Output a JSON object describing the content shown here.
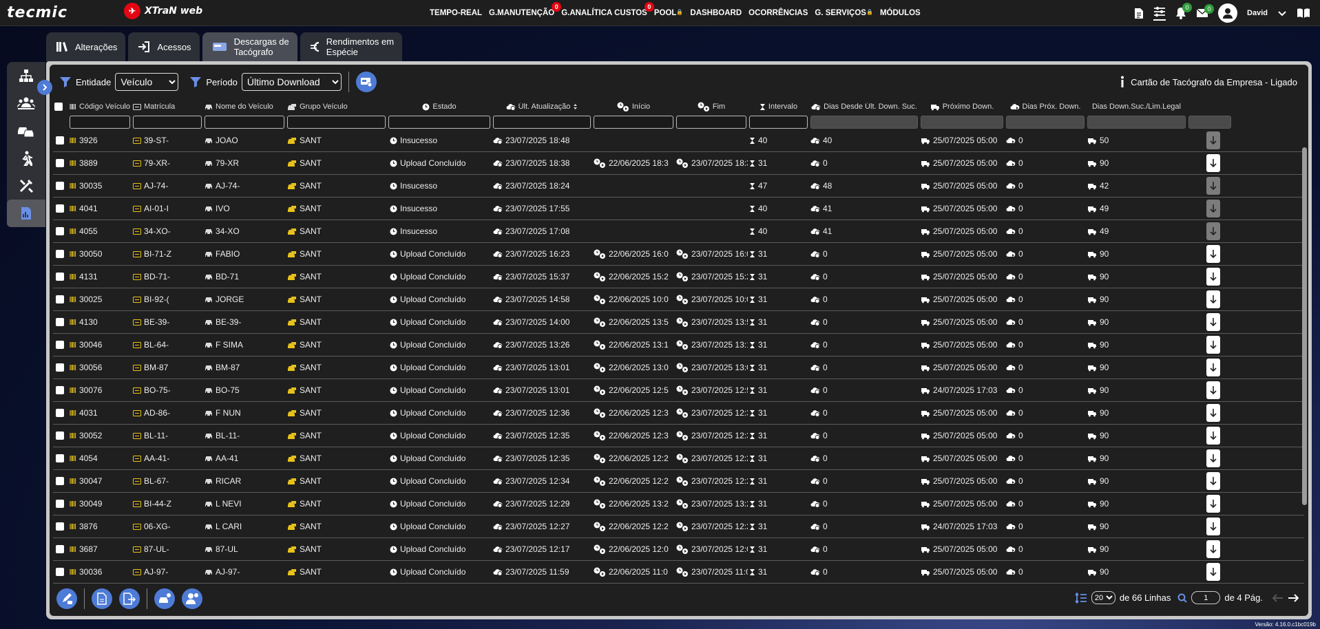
{
  "brand": {
    "logo": "tecmic",
    "product": "XTraN web"
  },
  "topnav": [
    {
      "label": "TEMPO-REAL"
    },
    {
      "label": "G.MANUTENÇÃO",
      "badge": "0"
    },
    {
      "label": "G.ANALÍTICA CUSTOS",
      "badge": "0"
    },
    {
      "label": "POOL",
      "locked": true
    },
    {
      "label": "DASHBOARD"
    },
    {
      "label": "OCORRÊNCIAS"
    },
    {
      "label": "G. SERVIÇOS",
      "locked": true
    },
    {
      "label": "MÓDULOS"
    }
  ],
  "user": {
    "name": "David",
    "notifications": "0",
    "messages": "0"
  },
  "tabs": [
    {
      "label": "Alterações",
      "icon": "books-icon"
    },
    {
      "label": "Acessos",
      "icon": "login-icon"
    },
    {
      "label": "Descargas de\nTacógrafo",
      "icon": "tachograph-card-icon",
      "active": true
    },
    {
      "label": "Rendimentos em\nEspécie",
      "icon": "euro-icon"
    }
  ],
  "sidenav": [
    "hierarchy-icon",
    "group-icon",
    "vehicles-icon",
    "person-walking-icon",
    "tools-icon",
    "report-icon"
  ],
  "filters": {
    "entity_label": "Entidade",
    "entity_value": "Veículo",
    "period_label": "Período",
    "period_value": "Último Download"
  },
  "card_status": "Cartão de Tacógrafo da Empresa - Ligado",
  "columns": [
    "Código Veículo",
    "Matrícula",
    "Nome do Veículo",
    "Grupo Veículo",
    "Estado",
    "Últ. Atualização",
    "Início",
    "Fim",
    "Intervalo",
    "Dias Desde Últ. Down. Suc.",
    "Próximo Down.",
    "Dias Próx. Down.",
    "Dias Down.Suc./Lim.Legal"
  ],
  "rows": [
    {
      "code": "3926",
      "plate": "39-ST-",
      "name": "JOAO",
      "group": "SANT",
      "state": "Insucesso",
      "updated": "23/07/2025 18:48",
      "start": "",
      "end": "",
      "interval": "40",
      "days_since": "40",
      "next": "25/07/2025 05:00",
      "days_next": "0",
      "limit": "50",
      "dl": false
    },
    {
      "code": "3889",
      "plate": "79-XR-",
      "name": "79-XR",
      "group": "SANT",
      "state": "Upload Concluído",
      "updated": "23/07/2025 18:38",
      "start": "22/06/2025 18:3",
      "end": "23/07/2025 18:3",
      "interval": "31",
      "days_since": "0",
      "next": "25/07/2025 05:00",
      "days_next": "0",
      "limit": "90",
      "dl": true
    },
    {
      "code": "30035",
      "plate": "AJ-74-",
      "name": "AJ-74-",
      "group": "SANT",
      "state": "Insucesso",
      "updated": "23/07/2025 18:24",
      "start": "",
      "end": "",
      "interval": "47",
      "days_since": "48",
      "next": "25/07/2025 05:00",
      "days_next": "0",
      "limit": "42",
      "dl": false
    },
    {
      "code": "4041",
      "plate": "AI-01-I",
      "name": "IVO",
      "group": "SANT",
      "state": "Insucesso",
      "updated": "23/07/2025 17:55",
      "start": "",
      "end": "",
      "interval": "40",
      "days_since": "41",
      "next": "25/07/2025 05:00",
      "days_next": "0",
      "limit": "49",
      "dl": false
    },
    {
      "code": "4055",
      "plate": "34-XO-",
      "name": "34-XO",
      "group": "SANT",
      "state": "Insucesso",
      "updated": "23/07/2025 17:08",
      "start": "",
      "end": "",
      "interval": "40",
      "days_since": "41",
      "next": "25/07/2025 05:00",
      "days_next": "0",
      "limit": "49",
      "dl": false
    },
    {
      "code": "30050",
      "plate": "BI-71-Z",
      "name": "FABIO",
      "group": "SANT",
      "state": "Upload Concluído",
      "updated": "23/07/2025 16:23",
      "start": "22/06/2025 16:0",
      "end": "23/07/2025 16:0",
      "interval": "31",
      "days_since": "0",
      "next": "25/07/2025 05:00",
      "days_next": "0",
      "limit": "90",
      "dl": true
    },
    {
      "code": "4131",
      "plate": "BD-71-",
      "name": "BD-71",
      "group": "SANT",
      "state": "Upload Concluído",
      "updated": "23/07/2025 15:37",
      "start": "22/06/2025 15:2",
      "end": "23/07/2025 15:2",
      "interval": "31",
      "days_since": "0",
      "next": "25/07/2025 05:00",
      "days_next": "0",
      "limit": "90",
      "dl": true
    },
    {
      "code": "30025",
      "plate": "BI-92-(",
      "name": "JORGE",
      "group": "SANT",
      "state": "Upload Concluído",
      "updated": "23/07/2025 14:58",
      "start": "22/06/2025 10:0",
      "end": "23/07/2025 10:0",
      "interval": "31",
      "days_since": "0",
      "next": "25/07/2025 05:00",
      "days_next": "0",
      "limit": "90",
      "dl": true
    },
    {
      "code": "4130",
      "plate": "BE-39-",
      "name": "BE-39-",
      "group": "SANT",
      "state": "Upload Concluído",
      "updated": "23/07/2025 14:00",
      "start": "22/06/2025 13:5",
      "end": "23/07/2025 13:5",
      "interval": "31",
      "days_since": "0",
      "next": "25/07/2025 05:00",
      "days_next": "0",
      "limit": "90",
      "dl": true
    },
    {
      "code": "30046",
      "plate": "BL-64-",
      "name": "F SIMA",
      "group": "SANT",
      "state": "Upload Concluído",
      "updated": "23/07/2025 13:26",
      "start": "22/06/2025 13:1",
      "end": "23/07/2025 13:1",
      "interval": "31",
      "days_since": "0",
      "next": "25/07/2025 05:00",
      "days_next": "0",
      "limit": "90",
      "dl": true
    },
    {
      "code": "30056",
      "plate": "BM-87",
      "name": "BM-87",
      "group": "SANT",
      "state": "Upload Concluído",
      "updated": "23/07/2025 13:01",
      "start": "22/06/2025 13:0",
      "end": "23/07/2025 13:0",
      "interval": "31",
      "days_since": "0",
      "next": "25/07/2025 05:00",
      "days_next": "0",
      "limit": "90",
      "dl": true
    },
    {
      "code": "30076",
      "plate": "BO-75-",
      "name": "BO-75",
      "group": "SANT",
      "state": "Upload Concluído",
      "updated": "23/07/2025 13:01",
      "start": "22/06/2025 12:5",
      "end": "23/07/2025 12:5",
      "interval": "31",
      "days_since": "0",
      "next": "24/07/2025 17:03",
      "days_next": "0",
      "limit": "90",
      "dl": true
    },
    {
      "code": "4031",
      "plate": "AD-86-",
      "name": "F NUN",
      "group": "SANT",
      "state": "Upload Concluído",
      "updated": "23/07/2025 12:36",
      "start": "22/06/2025 12:3",
      "end": "23/07/2025 12:3",
      "interval": "31",
      "days_since": "0",
      "next": "25/07/2025 05:00",
      "days_next": "0",
      "limit": "90",
      "dl": true
    },
    {
      "code": "30052",
      "plate": "BL-11-",
      "name": "BL-11-",
      "group": "SANT",
      "state": "Upload Concluído",
      "updated": "23/07/2025 12:35",
      "start": "22/06/2025 12:3",
      "end": "23/07/2025 12:3",
      "interval": "31",
      "days_since": "0",
      "next": "25/07/2025 05:00",
      "days_next": "0",
      "limit": "90",
      "dl": true
    },
    {
      "code": "4054",
      "plate": "AA-41-",
      "name": "AA-41",
      "group": "SANT",
      "state": "Upload Concluído",
      "updated": "23/07/2025 12:35",
      "start": "22/06/2025 12:2",
      "end": "23/07/2025 12:2",
      "interval": "31",
      "days_since": "0",
      "next": "25/07/2025 05:00",
      "days_next": "0",
      "limit": "90",
      "dl": true
    },
    {
      "code": "30047",
      "plate": "BL-67-",
      "name": "RICAR",
      "group": "SANT",
      "state": "Upload Concluído",
      "updated": "23/07/2025 12:34",
      "start": "22/06/2025 12:2",
      "end": "23/07/2025 12:2",
      "interval": "31",
      "days_since": "0",
      "next": "25/07/2025 05:00",
      "days_next": "0",
      "limit": "90",
      "dl": true
    },
    {
      "code": "30049",
      "plate": "BI-44-Z",
      "name": "L NEVI",
      "group": "SANT",
      "state": "Upload Concluído",
      "updated": "23/07/2025 12:29",
      "start": "22/06/2025 13:2",
      "end": "23/07/2025 13:2",
      "interval": "31",
      "days_since": "0",
      "next": "25/07/2025 05:00",
      "days_next": "0",
      "limit": "90",
      "dl": true
    },
    {
      "code": "3876",
      "plate": "06-XG-",
      "name": "L CARI",
      "group": "SANT",
      "state": "Upload Concluído",
      "updated": "23/07/2025 12:27",
      "start": "22/06/2025 12:2",
      "end": "23/07/2025 12:2",
      "interval": "31",
      "days_since": "0",
      "next": "24/07/2025 17:03",
      "days_next": "0",
      "limit": "90",
      "dl": true
    },
    {
      "code": "3687",
      "plate": "87-UL-",
      "name": "87-UL",
      "group": "SANT",
      "state": "Upload Concluído",
      "updated": "23/07/2025 12:17",
      "start": "22/06/2025 12:0",
      "end": "23/07/2025 12:0",
      "interval": "31",
      "days_since": "0",
      "next": "25/07/2025 05:00",
      "days_next": "0",
      "limit": "90",
      "dl": true
    },
    {
      "code": "30036",
      "plate": "AJ-97-",
      "name": "AJ-97-",
      "group": "SANT",
      "state": "Upload Concluído",
      "updated": "23/07/2025 11:59",
      "start": "22/06/2025 11:0",
      "end": "23/07/2025 11:0",
      "interval": "31",
      "days_since": "0",
      "next": "25/07/2025 05:00",
      "days_next": "0",
      "limit": "90",
      "dl": true
    }
  ],
  "pagination": {
    "rows_per_page": "20",
    "rows_total": "de 66 Linhas",
    "page": "1",
    "pages_total": "de 4 Pág."
  },
  "version": "Versão: 4.16.0.c1bc019b",
  "colors": {
    "accent": "#4e7bd6",
    "badge_red": "#e30613",
    "badge_green": "#2e9d3a",
    "plate_yellow": "#e8c21a"
  }
}
